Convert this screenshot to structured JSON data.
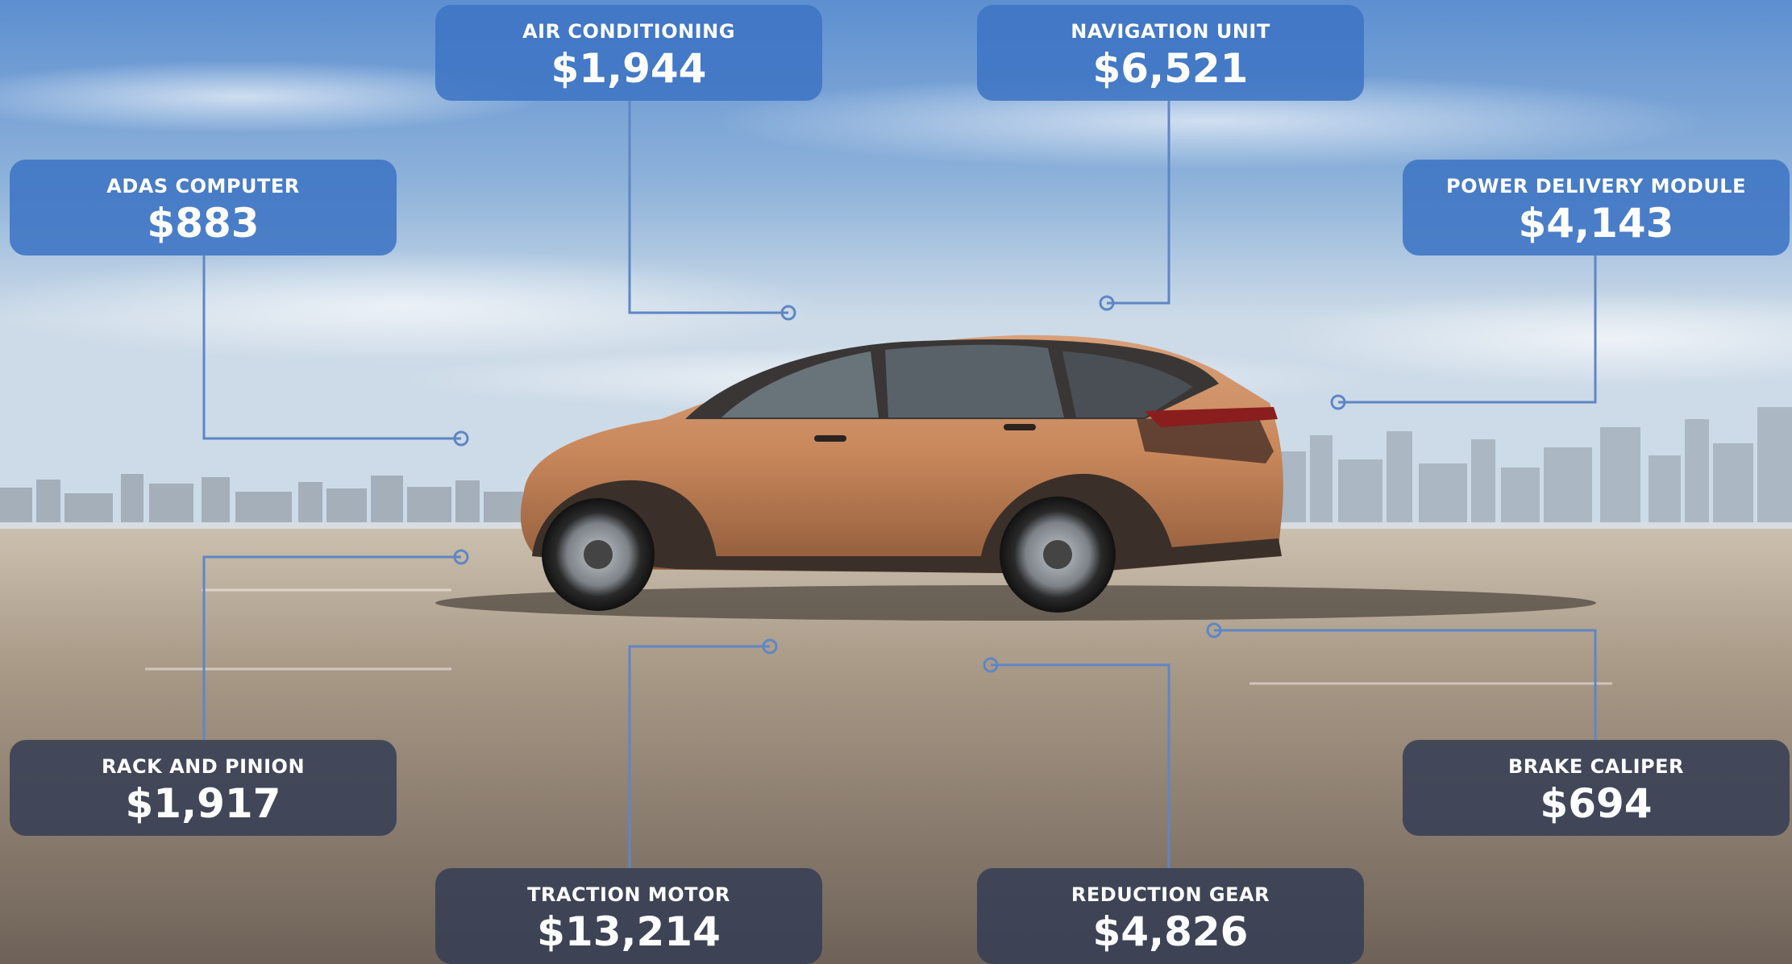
{
  "components": [
    {
      "key": "air-conditioning",
      "label": "AIR CONDITIONING",
      "price": "$1,944"
    },
    {
      "key": "navigation-unit",
      "label": "NAVIGATION UNIT",
      "price": "$6,521"
    },
    {
      "key": "adas-computer",
      "label": "ADAS COMPUTER",
      "price": "$883"
    },
    {
      "key": "power-delivery-module",
      "label": "POWER DELIVERY MODULE",
      "price": "$4,143"
    },
    {
      "key": "rack-and-pinion",
      "label": "RACK AND PINION",
      "price": "$1,917"
    },
    {
      "key": "brake-caliper",
      "label": "BRAKE CALIPER",
      "price": "$694"
    },
    {
      "key": "traction-motor",
      "label": "TRACTION MOTOR",
      "price": "$13,214"
    },
    {
      "key": "reduction-gear",
      "label": "REDUCTION GEAR",
      "price": "$4,826"
    }
  ],
  "colors": {
    "card_blue": "#3e74c4",
    "card_dark": "#343e54",
    "leader_line": "#5f86c4",
    "car_body": "#c8875a",
    "car_roof": "#3a3636"
  }
}
